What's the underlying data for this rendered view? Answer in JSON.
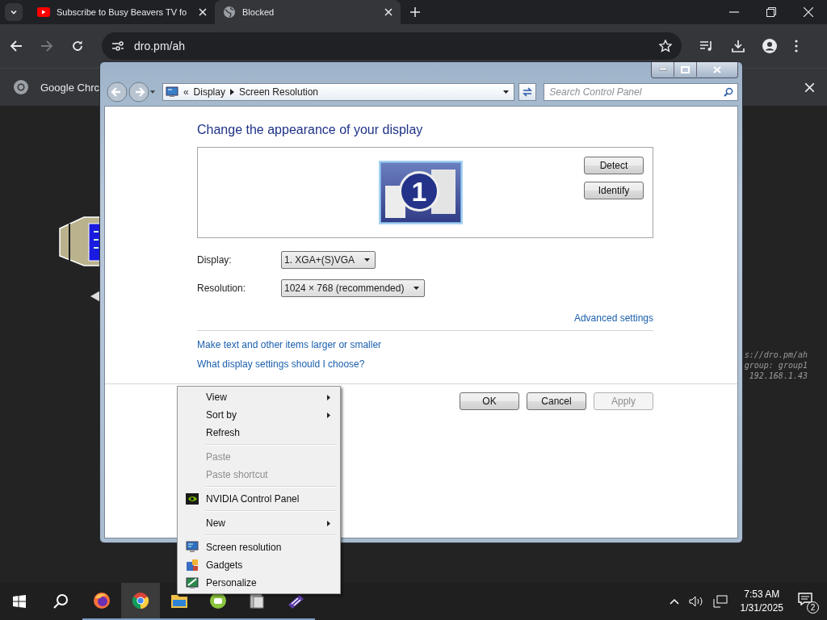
{
  "browser": {
    "tabs": [
      {
        "title": "Subscribe to Busy Beavers TV fo",
        "kind": "video",
        "selected": false
      },
      {
        "title": "Blocked",
        "kind": "globe",
        "selected": true
      }
    ],
    "address": "dro.pm/ah",
    "infobar": {
      "text": "Google Chrc"
    }
  },
  "remote_desktop": {
    "overlay_lines": [
      "s://dro.pm/ah",
      "group: group1",
      "192.168.1.43"
    ]
  },
  "dialog": {
    "breadcrumb_overflow": "«",
    "breadcrumb": [
      "Display",
      "Screen Resolution"
    ],
    "search": {
      "placeholder": "Search Control Panel"
    },
    "heading": "Change the appearance of your display",
    "monitor_number": "1",
    "side_buttons": [
      "Detect",
      "Identify"
    ],
    "fields": [
      {
        "label": "Display:",
        "value": "1. XGA+(S)VGA"
      },
      {
        "label": "Resolution:",
        "value": "1024 × 768 (recommended)"
      }
    ],
    "advanced_link": "Advanced settings",
    "links": [
      "Make text and other items larger or smaller",
      "What display settings should I choose?"
    ],
    "buttons": [
      {
        "label": "OK",
        "disabled": false
      },
      {
        "label": "Cancel",
        "disabled": false
      },
      {
        "label": "Apply",
        "disabled": true
      }
    ]
  },
  "context_menu": {
    "groups": [
      [
        {
          "label": "View",
          "kind": "plain",
          "submenu": true,
          "disabled": false
        },
        {
          "label": "Sort by",
          "kind": "plain",
          "submenu": true,
          "disabled": false
        },
        {
          "label": "Refresh",
          "kind": "plain",
          "submenu": false,
          "disabled": false
        }
      ],
      [
        {
          "label": "Paste",
          "kind": "plain",
          "submenu": false,
          "disabled": true
        },
        {
          "label": "Paste shortcut",
          "kind": "plain",
          "submenu": false,
          "disabled": true
        }
      ],
      [
        {
          "label": "NVIDIA Control Panel",
          "kind": "nvidia",
          "submenu": false,
          "disabled": false
        }
      ],
      [
        {
          "label": "New",
          "kind": "plain",
          "submenu": true,
          "disabled": false
        }
      ],
      [
        {
          "label": "Screen resolution",
          "kind": "screen",
          "submenu": false,
          "disabled": false
        },
        {
          "label": "Gadgets",
          "kind": "gadgets",
          "submenu": false,
          "disabled": false
        },
        {
          "label": "Personalize",
          "kind": "personalize",
          "submenu": false,
          "disabled": false
        }
      ]
    ]
  },
  "taskbar": {
    "apps": [
      {
        "kind": "firefox",
        "selected": false
      },
      {
        "kind": "chrome",
        "selected": true
      },
      {
        "kind": "folder",
        "selected": false
      },
      {
        "kind": "green",
        "selected": false
      },
      {
        "kind": "gray",
        "selected": false
      },
      {
        "kind": "purple",
        "selected": false
      }
    ],
    "clock": {
      "time": "7:53 AM",
      "date": "1/31/2025"
    },
    "notification_count": "2"
  }
}
